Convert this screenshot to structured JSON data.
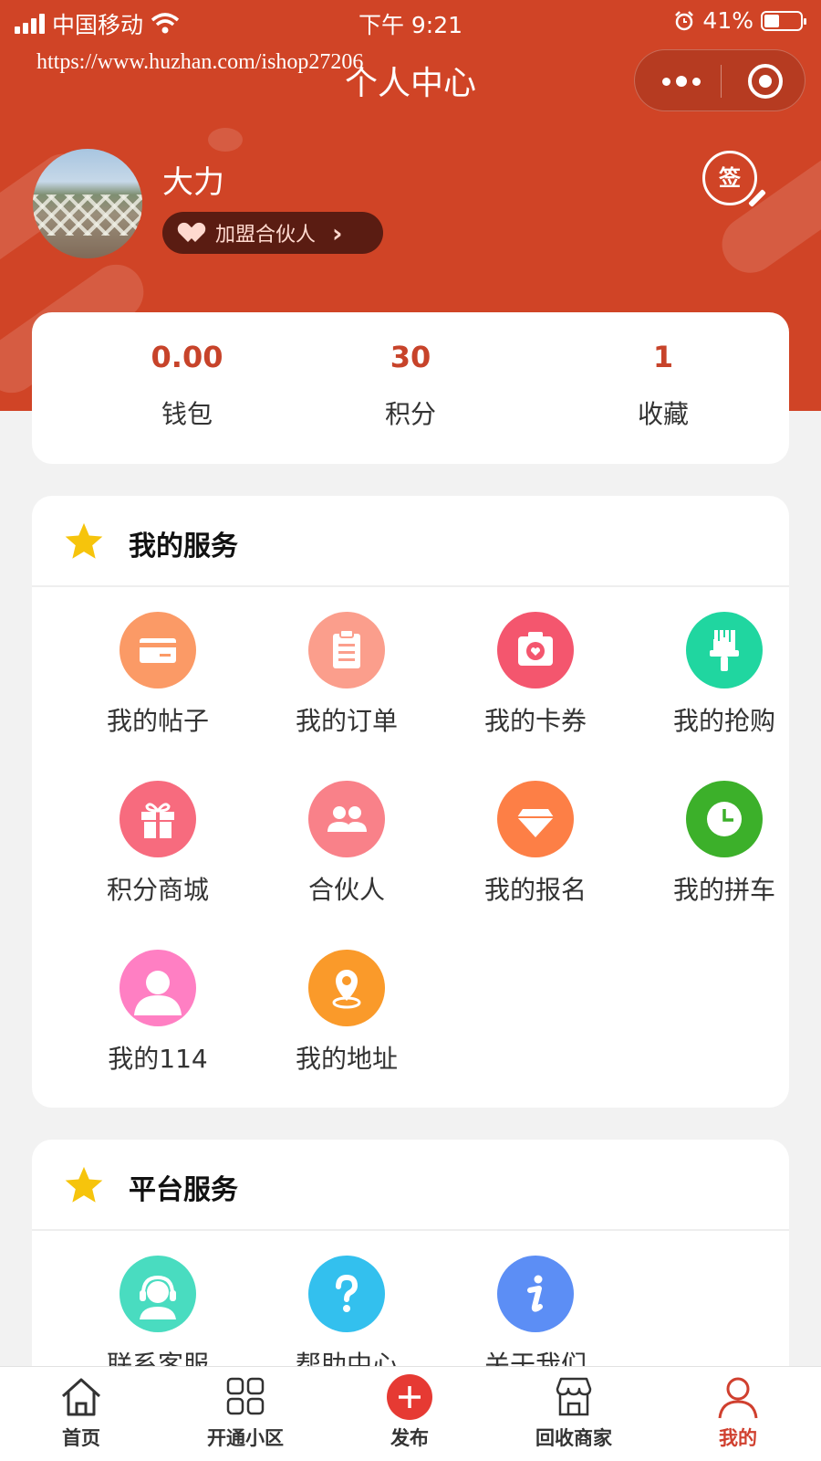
{
  "status_bar": {
    "carrier": "中国移动",
    "time": "下午 9:21",
    "battery": "41%",
    "battery_level": 0.41
  },
  "nav": {
    "title": "个人中心",
    "watermark": "https://www.huzhan.com/ishop27206"
  },
  "profile": {
    "name": "大力",
    "partner_label": "加盟合伙人",
    "sign_label": "签"
  },
  "stats": [
    {
      "value": "0.00",
      "label": "钱包"
    },
    {
      "value": "30",
      "label": "积分"
    },
    {
      "value": "1",
      "label": "收藏"
    }
  ],
  "my_services": {
    "title": "我的服务",
    "items": [
      {
        "label": "我的帖子",
        "icon": "card-icon",
        "color": "#fb9a66"
      },
      {
        "label": "我的订单",
        "icon": "clipboard-icon",
        "color": "#fb9e8c"
      },
      {
        "label": "我的卡券",
        "icon": "camera-icon",
        "color": "#f4566e"
      },
      {
        "label": "我的抢购",
        "icon": "brush-icon",
        "color": "#20d6a0"
      },
      {
        "label": "积分商城",
        "icon": "gift-icon",
        "color": "#f76b7e"
      },
      {
        "label": "合伙人",
        "icon": "people-icon",
        "color": "#f98189"
      },
      {
        "label": "我的报名",
        "icon": "diamond-icon",
        "color": "#fd7f46"
      },
      {
        "label": "我的拼车",
        "icon": "clock-icon",
        "color": "#3cb02a"
      },
      {
        "label": "我的114",
        "icon": "user-icon",
        "color": "#ff7fc3"
      },
      {
        "label": "我的地址",
        "icon": "location-pin-icon",
        "color": "#fa9a2a"
      }
    ]
  },
  "platform_services": {
    "title": "平台服务",
    "items": [
      {
        "label": "联系客服",
        "icon": "headset-icon",
        "color": "#49dcc0"
      },
      {
        "label": "帮助中心",
        "icon": "question-icon",
        "color": "#33c0ee"
      },
      {
        "label": "关于我们",
        "icon": "info-icon",
        "color": "#5c8ef5"
      }
    ]
  },
  "tabbar": [
    {
      "label": "首页",
      "icon": "home-icon"
    },
    {
      "label": "开通小区",
      "icon": "grid-icon"
    },
    {
      "label": "发布",
      "icon": "plus-icon"
    },
    {
      "label": "回收商家",
      "icon": "store-icon"
    },
    {
      "label": "我的",
      "icon": "profile-icon",
      "active": true
    }
  ],
  "colors": {
    "header": "#d04426",
    "accent": "#c7432a",
    "active_tab": "#d0402f",
    "star": "#f6c40c"
  }
}
